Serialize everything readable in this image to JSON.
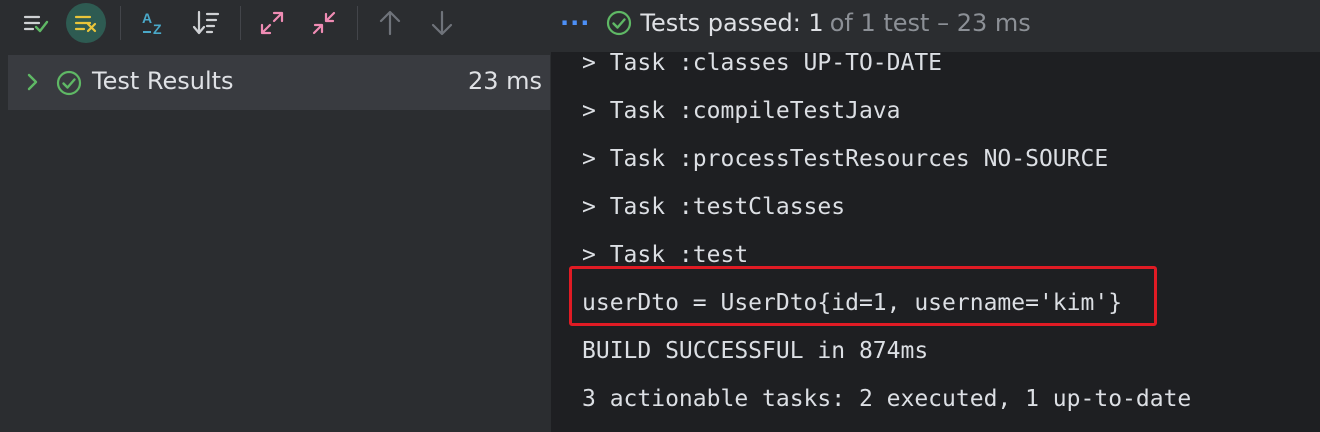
{
  "toolbar": {
    "buttons": [
      {
        "name": "show-passed-icon"
      },
      {
        "name": "show-ignored-icon"
      },
      {
        "name": "sort-alphabetically-icon"
      },
      {
        "name": "sort-by-duration-icon"
      },
      {
        "name": "expand-all-icon"
      },
      {
        "name": "collapse-all-icon"
      },
      {
        "name": "previous-failed-icon"
      },
      {
        "name": "next-failed-icon"
      }
    ],
    "more_label": "···",
    "status_passed": "Tests passed: 1",
    "status_count": "of 1 test – 23 ms"
  },
  "tree": {
    "label": "Test Results",
    "duration": "23 ms"
  },
  "console": {
    "lines": [
      "> Task :classes UP-TO-DATE",
      "> Task :compileTestJava",
      "> Task :processTestResources NO-SOURCE",
      "> Task :testClasses",
      "> Task :test",
      "userDto = UserDto{id=1, username='kim'}",
      "BUILD SUCCESSFUL in 874ms",
      "3 actionable tasks: 2 executed, 1 up-to-date"
    ]
  },
  "colors": {
    "accent_green": "#5fb865",
    "highlight_red": "#e01b24",
    "link_blue": "#4c8ff7"
  }
}
